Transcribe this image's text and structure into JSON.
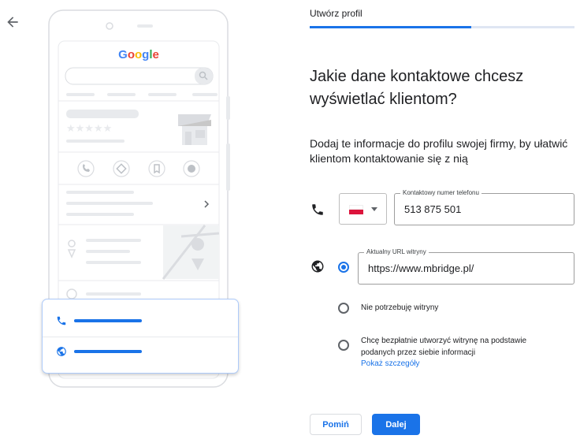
{
  "header": {
    "title": "Utwórz profil",
    "progress": 0.61
  },
  "main": {
    "heading": "Jakie dane kontaktowe chcesz wyświetlać klientom?",
    "subtitle": "Dodaj te informacje do profilu swojej firmy, by ułatwić klientom kontaktowanie się z nią"
  },
  "phone": {
    "country_flag": "poland-flag",
    "label": "Kontaktowy numer telefonu",
    "value": "513 875 501"
  },
  "website": {
    "url_label": "Aktualny URL witryny",
    "url_value": "https://www.mbridge.pl/",
    "selected_option": "url",
    "option_none": "Nie potrzebuję witryny",
    "option_create": "Chcę bezpłatnie utworzyć witrynę na podstawie podanych przez siebie informacji",
    "details_link": "Pokaż szczegóły"
  },
  "buttons": {
    "skip": "Pomiń",
    "next": "Dalej"
  },
  "illustration": {
    "logo_text": "Google",
    "icons": [
      "phone-icon",
      "directions-icon",
      "bookmark-icon",
      "globe-icon",
      "chevron-right-icon",
      "location-pin-icon",
      "clock-icon"
    ]
  },
  "colors": {
    "accent": "#1a73e8",
    "text": "#202124",
    "progress_track": "#dfe6f3"
  }
}
